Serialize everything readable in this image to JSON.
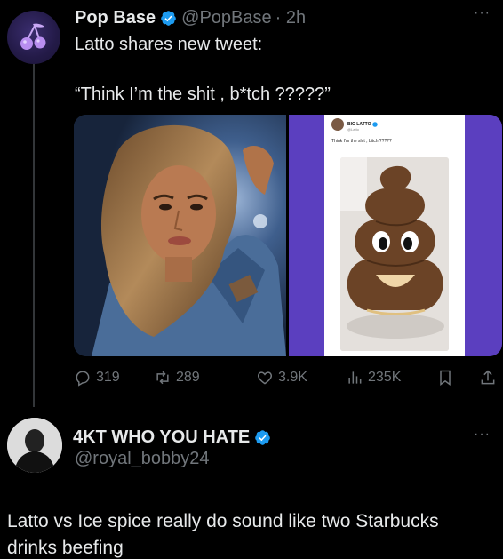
{
  "post": {
    "author_name": "Pop Base",
    "author_handle": "@PopBase",
    "timestamp": "· 2h",
    "more": "···",
    "text_line1": "Latto shares new tweet:",
    "text_line2": "“Think I’m the shit , b*tch ?????”",
    "media": {
      "embedded_card": {
        "name": "BIG LATTO",
        "handle": "@Latto",
        "text": "Think I’m the shit , bitch ?????"
      }
    },
    "actions": {
      "replies": "319",
      "reposts": "289",
      "likes": "3.9K",
      "views": "235K"
    }
  },
  "reply": {
    "author_name": "4KT WHO YOU HATE",
    "author_handle": "@royal_bobby24",
    "more": "···",
    "text": "Latto vs Ice spice really do sound like two Starbucks drinks beefing"
  },
  "colors": {
    "background": "#000000",
    "text": "#e7e9ea",
    "secondary": "#71767b",
    "verified": "#1d9bf0",
    "thread_line": "#333639"
  },
  "icons": [
    "cherries-logo-icon",
    "verified-badge-icon",
    "reply-icon",
    "repost-icon",
    "like-icon",
    "views-icon",
    "bookmark-icon",
    "share-icon"
  ]
}
